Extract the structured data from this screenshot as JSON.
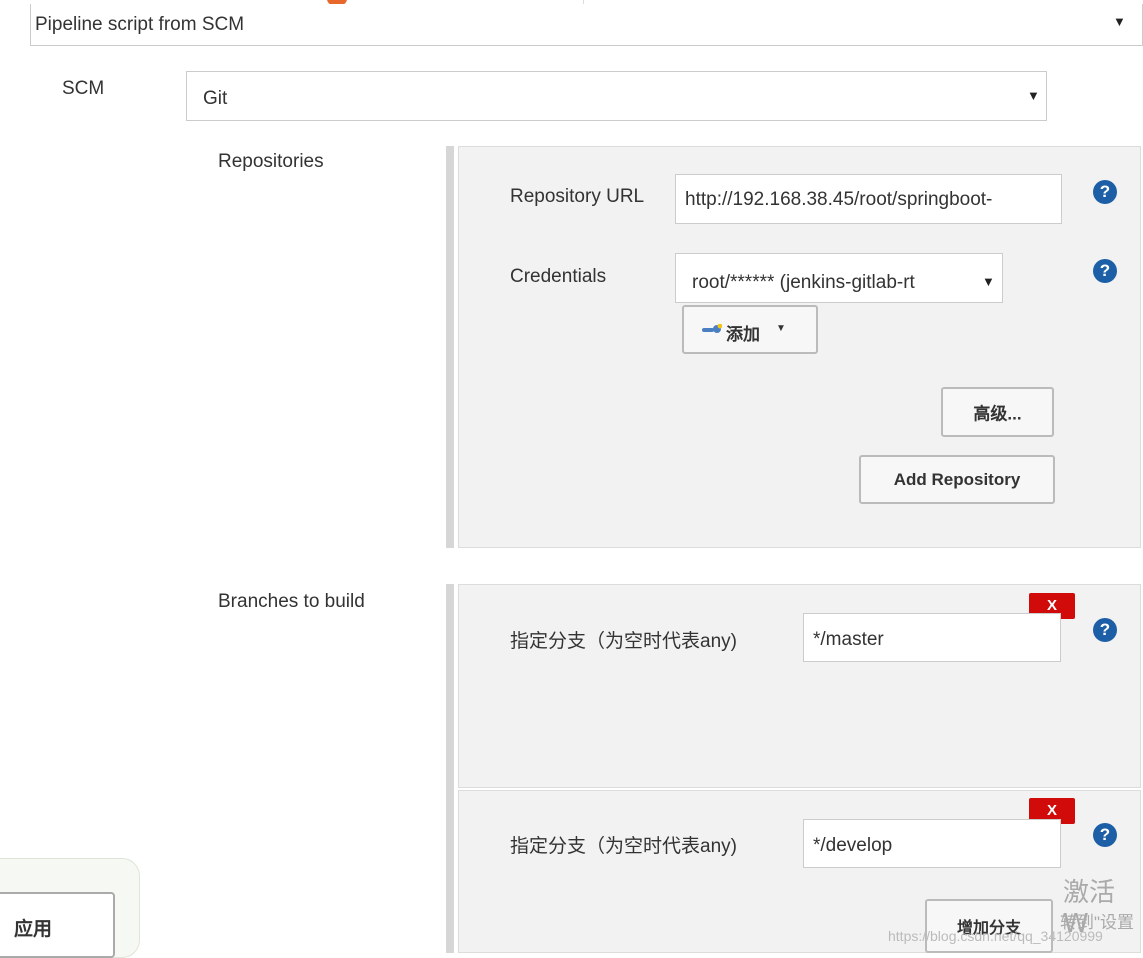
{
  "definition": {
    "value": "Pipeline script from SCM"
  },
  "scm": {
    "label": "SCM",
    "value": "Git"
  },
  "repositories": {
    "label": "Repositories",
    "url_label": "Repository URL",
    "url_value": "http://192.168.38.45/root/springboot-",
    "credentials_label": "Credentials",
    "credentials_value": "root/****** (jenkins-gitlab-rt",
    "add_label": "添加",
    "advanced_label": "高级...",
    "add_repo_label": "Add Repository"
  },
  "branches": {
    "label": "Branches to build",
    "items": [
      {
        "label": "指定分支（为空时代表any)",
        "value": "*/master"
      },
      {
        "label": "指定分支（为空时代表any)",
        "value": "*/develop"
      }
    ],
    "add_branch_label": "增加分支",
    "delete_label": "X"
  },
  "help_glyph": "?",
  "apply_label": "应用",
  "watermark": "https://blog.csdn.net/qq_34120999",
  "activate_text": "激活 W",
  "activate_sub": "转到\"设置",
  "colors": {
    "help": "#1d5fa6",
    "delete": "#d10a0a",
    "panel": "#f2f2f2"
  }
}
